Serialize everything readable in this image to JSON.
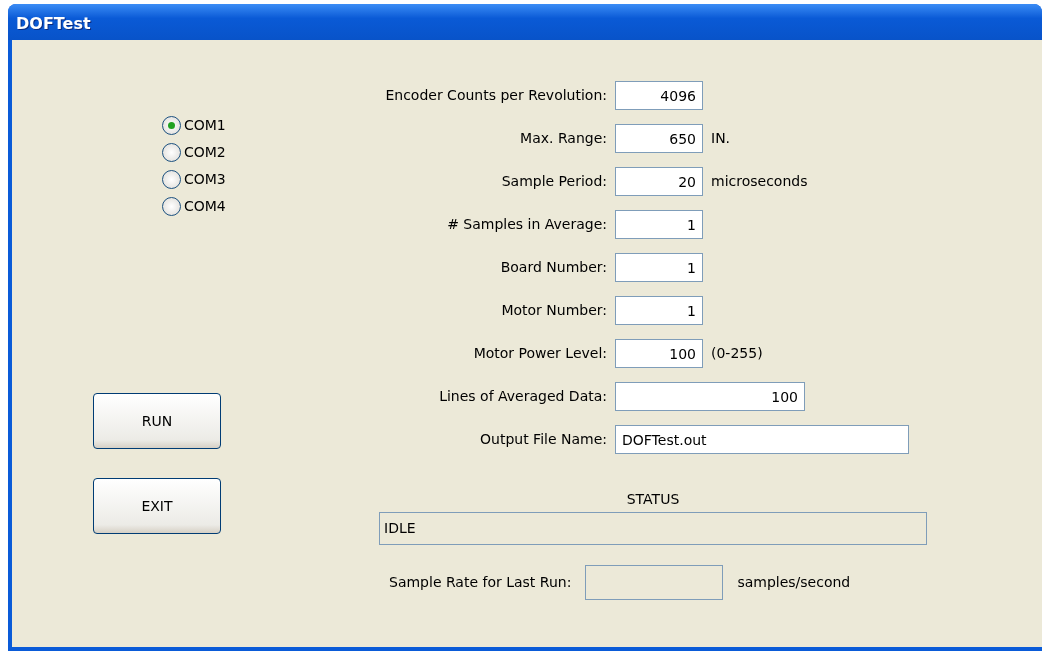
{
  "window": {
    "title": "DOFTest"
  },
  "ports": [
    {
      "label": "COM1",
      "selected": true
    },
    {
      "label": "COM2",
      "selected": false
    },
    {
      "label": "COM3",
      "selected": false
    },
    {
      "label": "COM4",
      "selected": false
    }
  ],
  "buttons": [
    "RUN",
    "EXIT"
  ],
  "fields": [
    {
      "kind": "number",
      "label": "Encoder Counts per Revolution:",
      "value": "4096"
    },
    {
      "kind": "number",
      "label": "Max. Range:",
      "value": "650",
      "unit": "IN."
    },
    {
      "kind": "number",
      "label": "Sample Period:",
      "value": "20",
      "unit": "microseconds"
    },
    {
      "kind": "number",
      "label": "# Samples in Average:",
      "value": "1"
    },
    {
      "kind": "number",
      "label": "Board Number:",
      "value": "1"
    },
    {
      "kind": "number",
      "label": "Motor Number:",
      "value": "1"
    },
    {
      "kind": "number",
      "label": "Motor Power Level:",
      "value": "100",
      "unit": "(0-255)"
    },
    {
      "kind": "count",
      "label": "Lines of Averaged Data:",
      "value": "100"
    },
    {
      "kind": "text",
      "label": "Output File Name:",
      "value": "DOFTest.out"
    }
  ],
  "status": {
    "label": "STATUS",
    "value": "IDLE"
  },
  "sample_rate": {
    "label": "Sample Rate for Last Run:",
    "unit": "samples/second"
  }
}
